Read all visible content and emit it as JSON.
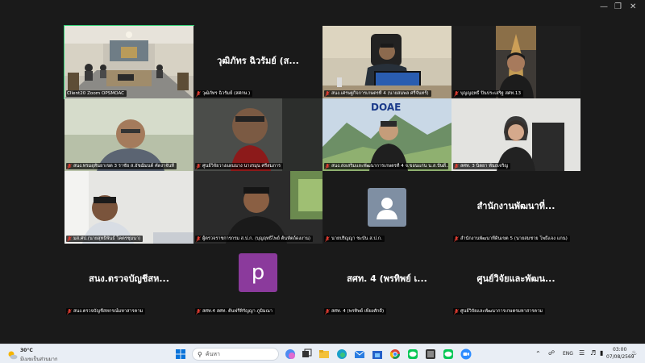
{
  "tiles": [
    {
      "name": "Client20 Zoom OPSMOAC",
      "muted": false,
      "active": true
    },
    {
      "big_name": "วุฒิภัทร ฉิวรัมย์ (ส...",
      "name": "วุฒิภัทร ฉิวรัมย์ (สศกษ.)",
      "muted": true
    },
    {
      "name": "สนง.เศรษฐกิจการเกษตรที่ 4 (นายสมพล ศรีจันทร์)",
      "muted": true
    },
    {
      "name": "บุญญฤทธิ์ ปิ่นประเสริฐ สศท.13",
      "muted": true
    },
    {
      "name": "สนง.ทรมอุทันยาเขต 3 ราชั่ย ส.อัชฌิมนต์ คัดงาจันที",
      "muted": true
    },
    {
      "name": "ศูนย์วิจัยวางแผนนาง นางรมุน ศรีสมภาร",
      "muted": true
    },
    {
      "name": "สนง.ส่งเสริมและพัฒนาการเกษตรที่ 4 จ.ขอนแก่น น.ส.ปันดี...",
      "muted": true,
      "logo": "DOAE"
    },
    {
      "name": "สศท. 3 นิตยา พันธเจริญ",
      "muted": true
    },
    {
      "name": "มส.ศป.(นายสุทธิพันธ์ โคตรชุมนา)",
      "muted": true
    },
    {
      "name": "ผู้ตรวจราชการกรม ส.ป.ก. (บุญฤทธิ์ไพย์ ต้นหัตถ์ดงงาน)",
      "muted": true
    },
    {
      "name": "นายปริญญา ชะบัน ส.ป.ก.",
      "muted": true
    },
    {
      "big_name": "สำนักงานพัฒนาที่...",
      "name": "สำนักงานพัฒนาที่ดินเขต 5 (นายสมชาย โพธิ์แจง แกน)",
      "muted": true
    },
    {
      "big_name": "สนง.ตรวจบัญชีสห...",
      "name": "สนง.ตรวจบัญชีสหกรณ์มหาสารคาม",
      "muted": true
    },
    {
      "letter": "p",
      "name": "สศท.4 สศท. ต้นฟรีหิรัญญา ภูมิมณา",
      "muted": true
    },
    {
      "big_name": "สศท. 4 (พรทิพย์ เ...",
      "name": "สศท. 4 (พรทิพย์ เพียงศักดิ์)",
      "muted": true
    },
    {
      "big_name": "ศูนย์วิจัยและพัฒน...",
      "name": "ศูนย์วิจัยและพัฒนาการเกษตรมหาสารคาม",
      "muted": true
    }
  ],
  "taskbar": {
    "weather_temp": "30°C",
    "weather_desc": "มีเมฆเป็นส่วนมาก",
    "search_placeholder": "ค้นหา",
    "lang": "ENG",
    "time": "03:00",
    "date": "07/08/2569"
  },
  "colors": {
    "active_outline": "#2ecc71",
    "mute_red": "#e03c31",
    "letter_avatar": "#8b3a9c"
  }
}
